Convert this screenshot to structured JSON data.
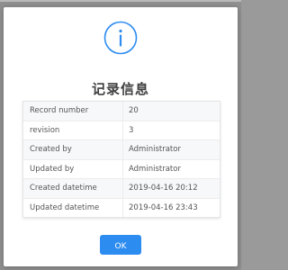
{
  "dialog": {
    "icon": "info-icon",
    "icon_color": "#2d8cf0",
    "title": "记录信息",
    "rows": [
      {
        "label": "Record number",
        "value": "20"
      },
      {
        "label": "revision",
        "value": "3"
      },
      {
        "label": "Created by",
        "value": "Administrator"
      },
      {
        "label": "Updated by",
        "value": "Administrator"
      },
      {
        "label": "Created datetime",
        "value": "2019-04-16 20:12"
      },
      {
        "label": "Updated datetime",
        "value": "2019-04-16 23:43"
      }
    ],
    "ok_label": "OK",
    "accent_color": "#2d8cf0"
  }
}
